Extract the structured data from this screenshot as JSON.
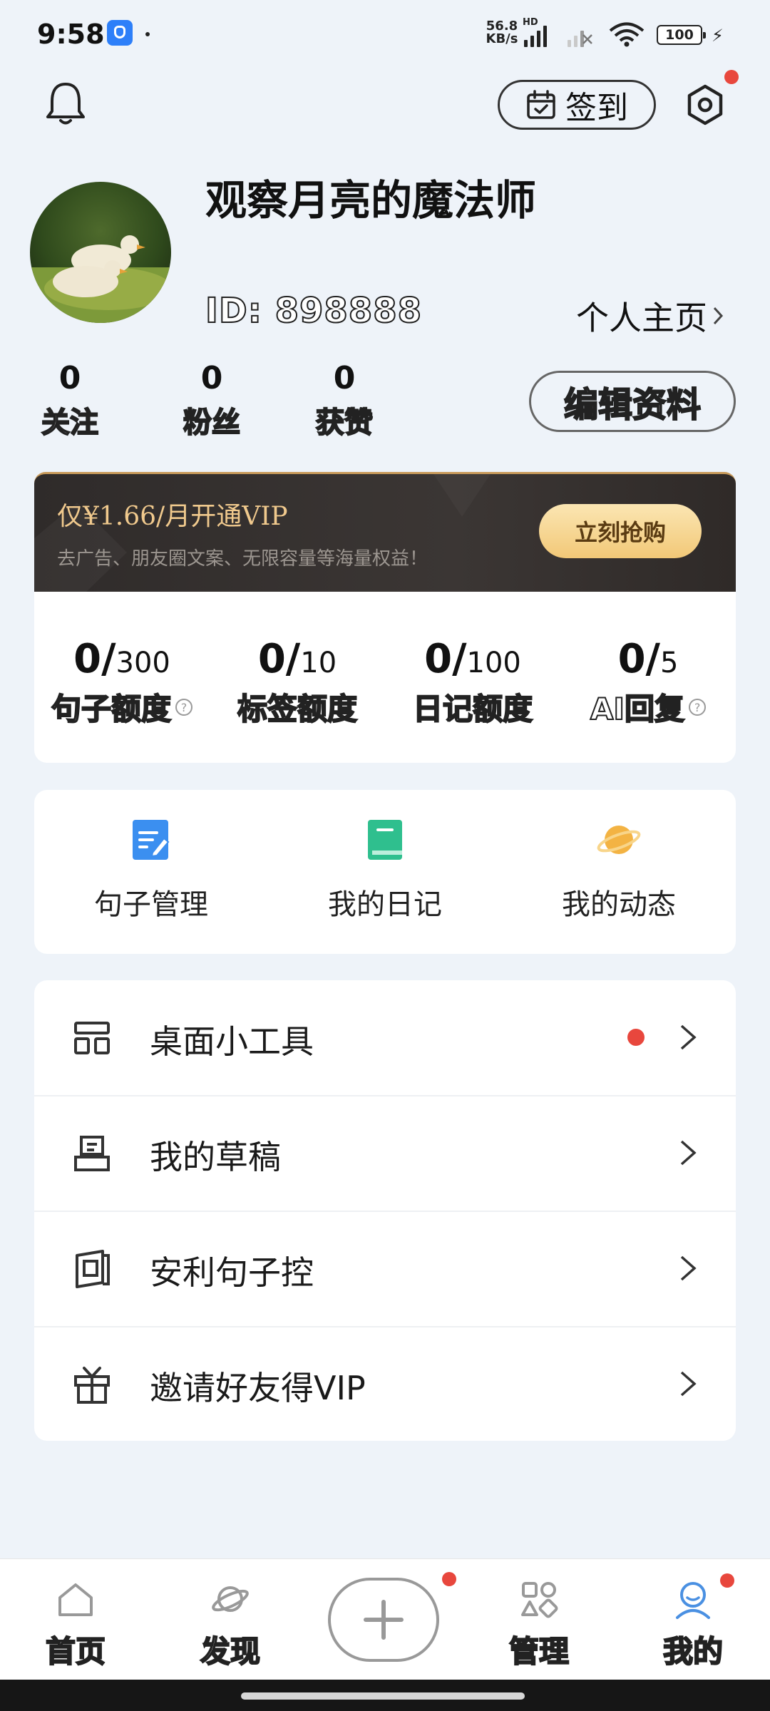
{
  "status_bar": {
    "time": "9:58",
    "net_speed_value": "56.8",
    "net_speed_unit": "KB/s",
    "network_label": "HD",
    "battery": "100"
  },
  "header": {
    "checkin_label": "签到"
  },
  "profile": {
    "name": "观察月亮的魔法师",
    "id": "ID: 898888",
    "homepage_label": "个人主页",
    "stats": [
      {
        "value": "0",
        "label": "关注"
      },
      {
        "value": "0",
        "label": "粉丝"
      },
      {
        "value": "0",
        "label": "获赞"
      }
    ],
    "edit_label": "编辑资料"
  },
  "vip": {
    "title": "仅¥1.66/月开通VIP",
    "subtitle": "去广告、朋友圈文案、无限容量等海量权益！",
    "button": "立刻抢购"
  },
  "quotas": [
    {
      "used": "0/",
      "limit": "300",
      "label": "句子额度",
      "help": true
    },
    {
      "used": "0/",
      "limit": "10",
      "label": "标签额度",
      "help": false
    },
    {
      "used": "0/",
      "limit": "100",
      "label": "日记额度",
      "help": false
    },
    {
      "used": "0/",
      "limit": "5",
      "label": "AI回复",
      "help": true
    }
  ],
  "shortcuts": [
    {
      "label": "句子管理",
      "icon": "edit-note-icon",
      "color": "#3b8ff0"
    },
    {
      "label": "我的日记",
      "icon": "diary-book-icon",
      "color": "#2fbf8e"
    },
    {
      "label": "我的动态",
      "icon": "planet-icon",
      "color": "#f3b343"
    }
  ],
  "menu": [
    {
      "label": "桌面小工具",
      "icon": "widgets-icon",
      "badge": true
    },
    {
      "label": "我的草稿",
      "icon": "draft-tray-icon",
      "badge": false
    },
    {
      "label": "安利句子控",
      "icon": "share-app-icon",
      "badge": false
    },
    {
      "label": "邀请好友得VIP",
      "icon": "gift-icon",
      "badge": false
    }
  ],
  "nav": [
    {
      "label": "首页",
      "icon": "home-icon"
    },
    {
      "label": "发现",
      "icon": "planet-outline-icon"
    },
    {
      "label": "管理",
      "icon": "shapes-icon"
    },
    {
      "label": "我的",
      "icon": "user-icon"
    }
  ],
  "colors": {
    "accent_red": "#e8473d",
    "vip_gold": "#f0c98d",
    "page_bg": "#eef3f9"
  }
}
